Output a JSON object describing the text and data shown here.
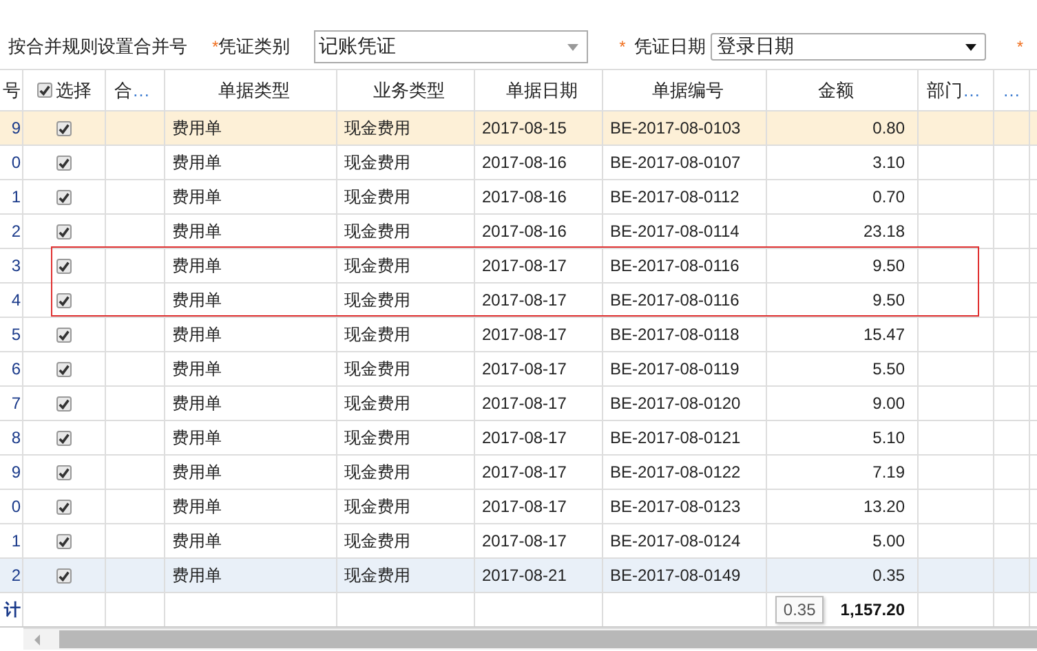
{
  "toolbar": {
    "merge_label": "按合并规则设置合并号",
    "fields": [
      {
        "mark": "*",
        "label": "凭证类别",
        "value": "记账凭证"
      },
      {
        "mark": "*",
        "label": "凭证日期",
        "value": "登录日期"
      },
      {
        "mark": "*"
      }
    ]
  },
  "table": {
    "columns": [
      "号",
      "选择",
      "合…",
      "单据类型",
      "业务类型",
      "单据日期",
      "单据编号",
      "金额",
      "部门…",
      "…"
    ],
    "select_all_checked": true,
    "rows": [
      {
        "no": "9",
        "checked": true,
        "selected": true,
        "hovered": false,
        "boxed": false,
        "bill_type": "费用单",
        "biz_type": "现金费用",
        "date": "2017-08-15",
        "bill_no": "BE-2017-08-0103",
        "amount": "0.80"
      },
      {
        "no": "0",
        "checked": true,
        "selected": false,
        "hovered": false,
        "boxed": false,
        "bill_type": "费用单",
        "biz_type": "现金费用",
        "date": "2017-08-16",
        "bill_no": "BE-2017-08-0107",
        "amount": "3.10"
      },
      {
        "no": "1",
        "checked": true,
        "selected": false,
        "hovered": false,
        "boxed": false,
        "bill_type": "费用单",
        "biz_type": "现金费用",
        "date": "2017-08-16",
        "bill_no": "BE-2017-08-0112",
        "amount": "0.70"
      },
      {
        "no": "2",
        "checked": true,
        "selected": false,
        "hovered": false,
        "boxed": false,
        "bill_type": "费用单",
        "biz_type": "现金费用",
        "date": "2017-08-16",
        "bill_no": "BE-2017-08-0114",
        "amount": "23.18"
      },
      {
        "no": "3",
        "checked": true,
        "selected": false,
        "hovered": false,
        "boxed": true,
        "bill_type": "费用单",
        "biz_type": "现金费用",
        "date": "2017-08-17",
        "bill_no": "BE-2017-08-0116",
        "amount": "9.50"
      },
      {
        "no": "4",
        "checked": true,
        "selected": false,
        "hovered": false,
        "boxed": true,
        "bill_type": "费用单",
        "biz_type": "现金费用",
        "date": "2017-08-17",
        "bill_no": "BE-2017-08-0116",
        "amount": "9.50"
      },
      {
        "no": "5",
        "checked": true,
        "selected": false,
        "hovered": false,
        "boxed": false,
        "bill_type": "费用单",
        "biz_type": "现金费用",
        "date": "2017-08-17",
        "bill_no": "BE-2017-08-0118",
        "amount": "15.47"
      },
      {
        "no": "6",
        "checked": true,
        "selected": false,
        "hovered": false,
        "boxed": false,
        "bill_type": "费用单",
        "biz_type": "现金费用",
        "date": "2017-08-17",
        "bill_no": "BE-2017-08-0119",
        "amount": "5.50"
      },
      {
        "no": "7",
        "checked": true,
        "selected": false,
        "hovered": false,
        "boxed": false,
        "bill_type": "费用单",
        "biz_type": "现金费用",
        "date": "2017-08-17",
        "bill_no": "BE-2017-08-0120",
        "amount": "9.00"
      },
      {
        "no": "8",
        "checked": true,
        "selected": false,
        "hovered": false,
        "boxed": false,
        "bill_type": "费用单",
        "biz_type": "现金费用",
        "date": "2017-08-17",
        "bill_no": "BE-2017-08-0121",
        "amount": "5.10"
      },
      {
        "no": "9",
        "checked": true,
        "selected": false,
        "hovered": false,
        "boxed": false,
        "bill_type": "费用单",
        "biz_type": "现金费用",
        "date": "2017-08-17",
        "bill_no": "BE-2017-08-0122",
        "amount": "7.19"
      },
      {
        "no": "0",
        "checked": true,
        "selected": false,
        "hovered": false,
        "boxed": false,
        "bill_type": "费用单",
        "biz_type": "现金费用",
        "date": "2017-08-17",
        "bill_no": "BE-2017-08-0123",
        "amount": "13.20"
      },
      {
        "no": "1",
        "checked": true,
        "selected": false,
        "hovered": false,
        "boxed": false,
        "bill_type": "费用单",
        "biz_type": "现金费用",
        "date": "2017-08-17",
        "bill_no": "BE-2017-08-0124",
        "amount": "5.00"
      },
      {
        "no": "2",
        "checked": true,
        "selected": false,
        "hovered": true,
        "boxed": false,
        "bill_type": "费用单",
        "biz_type": "现金费用",
        "date": "2017-08-21",
        "bill_no": "BE-2017-08-0149",
        "amount": "0.35"
      }
    ],
    "total": {
      "label": "计",
      "tooltip": "0.35",
      "amount": "1,157.20"
    }
  }
}
